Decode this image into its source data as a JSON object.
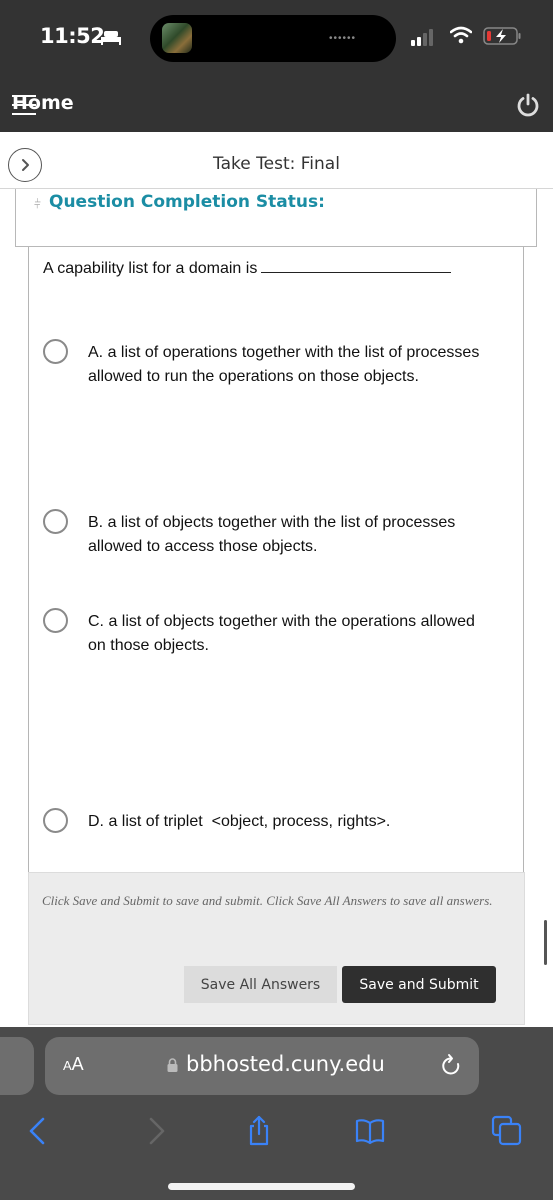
{
  "status_bar": {
    "time": "11:52",
    "sleep_icon": "bed-icon",
    "signal_icon": "cellular-signal-icon",
    "wifi_icon": "wifi-icon",
    "battery_icon": "battery-charging-low-icon"
  },
  "header": {
    "home_label": "Home",
    "menu_icon": "hamburger-menu-icon",
    "power_icon": "power-icon"
  },
  "title_bar": {
    "expand_icon": "chevron-right-circle-icon",
    "title": "Take Test: Final"
  },
  "completion_status": {
    "chevron_icon": "double-chevron-down-icon",
    "label": "Question Completion Status:"
  },
  "question": {
    "text": "A capability list for a domain is",
    "options": [
      {
        "letter": "A",
        "label": "A. a list of operations together with the list of processes allowed to run the operations on those objects.",
        "selected": false
      },
      {
        "letter": "B",
        "label": "B. a list of objects together with the list of processes allowed to access those objects.",
        "selected": false
      },
      {
        "letter": "C",
        "label": "C. a list of objects together with the operations allowed on those objects.",
        "selected": false
      },
      {
        "letter": "D",
        "label": "D. a list of triplet  <object, process, rights>.",
        "selected": false
      }
    ]
  },
  "footer": {
    "note": "Click Save and Submit to save and submit. Click Save All Answers to save all answers.",
    "save_all_label": "Save All Answers",
    "save_submit_label": "Save and Submit"
  },
  "browser": {
    "text_size_label_small": "A",
    "text_size_label_large": "A",
    "url": "bbhosted.cuny.edu",
    "lock_icon": "lock-icon",
    "reload_icon": "reload-icon",
    "back_icon": "back-chevron-icon",
    "forward_icon": "forward-chevron-icon",
    "share_icon": "share-icon",
    "bookmarks_icon": "bookmarks-book-icon",
    "tabs_icon": "tabs-icon",
    "accent_color": "#3a82f7"
  }
}
